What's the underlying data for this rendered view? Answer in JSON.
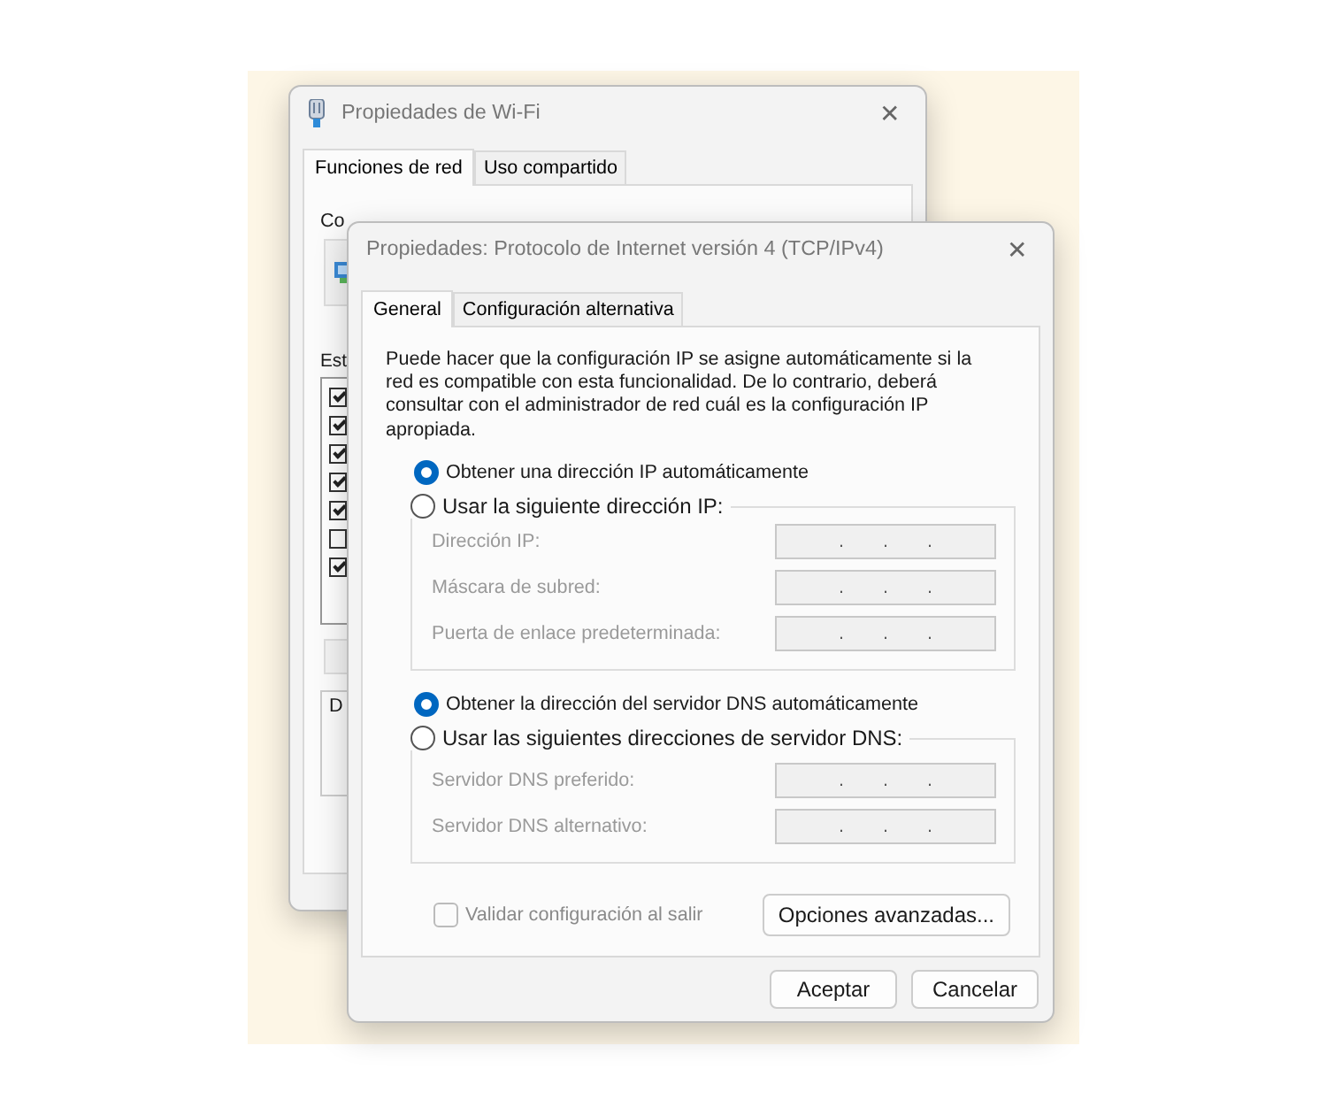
{
  "background_window": {
    "title": "Propiedades de Wi-Fi",
    "close": "✕",
    "tabs": [
      {
        "label": "Funciones de red",
        "selected": true
      },
      {
        "label": "Uso compartido",
        "selected": false
      }
    ],
    "connect_label": "Co",
    "list_label": "Est",
    "components": [
      {
        "checked": true
      },
      {
        "checked": true
      },
      {
        "checked": true
      },
      {
        "checked": true
      },
      {
        "checked": true
      },
      {
        "checked": false
      },
      {
        "checked": true
      }
    ],
    "group_label": "D"
  },
  "dialog": {
    "title": "Propiedades: Protocolo de Internet versión 4 (TCP/IPv4)",
    "close": "✕",
    "tabs": [
      {
        "label": "General",
        "selected": true
      },
      {
        "label": "Configuración alternativa",
        "selected": false
      }
    ],
    "description": "Puede hacer que la configuración IP se asigne automáticamente si la red es compatible con esta funcionalidad. De lo contrario, deberá consultar con el administrador de red cuál es la configuración IP apropiada.",
    "ip_auto": {
      "label": "Obtener una dirección IP automáticamente",
      "selected": true
    },
    "ip_manual": {
      "label": "Usar la siguiente dirección IP:",
      "selected": false,
      "fields": [
        {
          "label": "Dirección IP:",
          "separator": ".",
          "disabled": true
        },
        {
          "label": "Máscara de subred:",
          "separator": ".",
          "disabled": true
        },
        {
          "label": "Puerta de enlace predeterminada:",
          "separator": ".",
          "disabled": true
        }
      ]
    },
    "dns_auto": {
      "label": "Obtener la dirección del servidor DNS automáticamente",
      "selected": true
    },
    "dns_manual": {
      "label": "Usar las siguientes direcciones de servidor DNS:",
      "selected": false,
      "fields": [
        {
          "label": "Servidor DNS preferido:",
          "separator": ".",
          "disabled": true
        },
        {
          "label": "Servidor DNS alternativo:",
          "separator": ".",
          "disabled": true
        }
      ]
    },
    "validate": {
      "label": "Validar configuración al salir",
      "checked": false,
      "disabled": true
    },
    "advanced_button": "Opciones avanzadas...",
    "buttons": [
      "Aceptar",
      "Cancelar"
    ]
  }
}
